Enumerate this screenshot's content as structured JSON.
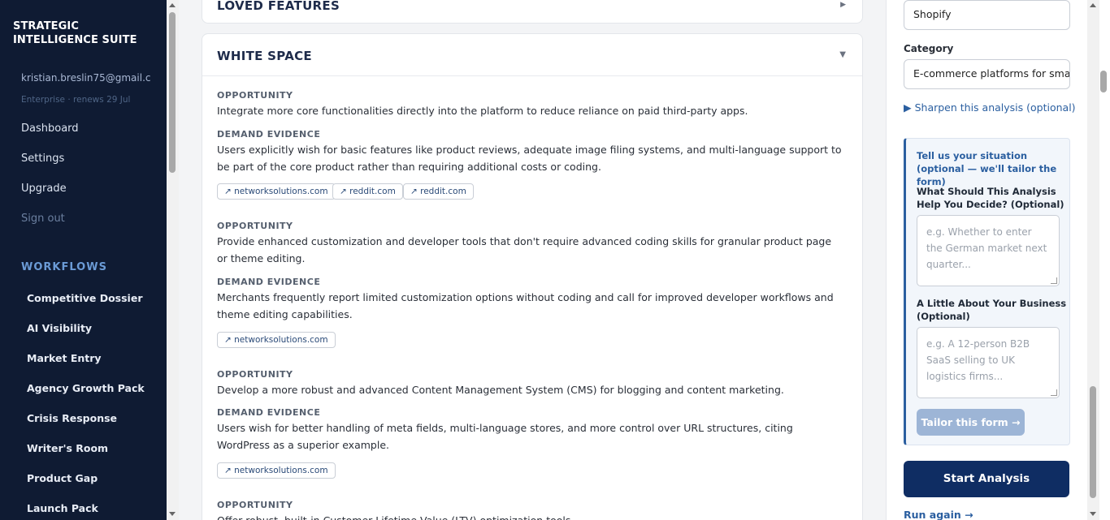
{
  "sidebar": {
    "brand": "STRATEGIC INTELLIGENCE SUITE",
    "email": "kristian.breslin75@gmail.c...",
    "plan": "Enterprise · renews 29 Jul",
    "nav": [
      "Dashboard",
      "Settings",
      "Upgrade",
      "Sign out"
    ],
    "workflows_title": "WORKFLOWS",
    "workflows": [
      "Competitive Dossier",
      "AI Visibility",
      "Market Entry",
      "Agency Growth Pack",
      "Crisis Response",
      "Writer's Room",
      "Product Gap",
      "Launch Pack"
    ]
  },
  "main": {
    "loved_title": "LOVED FEATURES",
    "white_title": "WHITE SPACE",
    "opportunity_label": "OPPORTUNITY",
    "demand_label": "DEMAND EVIDENCE",
    "items": [
      {
        "opportunity": "Integrate more core functionalities directly into the platform to reduce reliance on paid third-party apps.",
        "demand": "Users explicitly wish for basic features like product reviews, adequate image filing systems, and multi-language support to be part of the core product rather than requiring additional costs or coding.",
        "sources": [
          "↗ networksolutions.com",
          "↗ reddit.com",
          "↗ reddit.com"
        ]
      },
      {
        "opportunity": "Provide enhanced customization and developer tools that don't require advanced coding skills for granular product page or theme editing.",
        "demand": "Merchants frequently report limited customization options without coding and call for improved developer workflows and theme editing capabilities.",
        "sources": [
          "↗ networksolutions.com"
        ]
      },
      {
        "opportunity": "Develop a more robust and advanced Content Management System (CMS) for blogging and content marketing.",
        "demand": "Users wish for better handling of meta fields, multi-language stores, and more control over URL structures, citing WordPress as a superior example.",
        "sources": [
          "↗ networksolutions.com"
        ]
      },
      {
        "opportunity": "Offer robust, built-in Customer Lifetime Value (LTV) optimization tools."
      }
    ]
  },
  "right": {
    "company_value": "Shopify",
    "category_label": "Category",
    "category_value": "E-commerce platforms for smal",
    "sharpen": "▶ Sharpen this analysis (optional)",
    "tell_title": "Tell us your situation (optional — we'll tailor the form)",
    "q1_label": "What Should This Analysis Help You Decide? (Optional)",
    "q1_placeholder": "e.g. Whether to enter the German market next quarter...",
    "q2_label": "A Little About Your Business (Optional)",
    "q2_placeholder": "e.g. A 12-person B2B SaaS selling to UK logistics firms...",
    "tailor_button": "Tailor this form →",
    "start_button": "Start Analysis",
    "run_again": "Run again →"
  },
  "colors": {
    "sidebar_bg": "#0f1b33",
    "accent": "#2b5fa0",
    "primary_button": "#0f2d63"
  }
}
